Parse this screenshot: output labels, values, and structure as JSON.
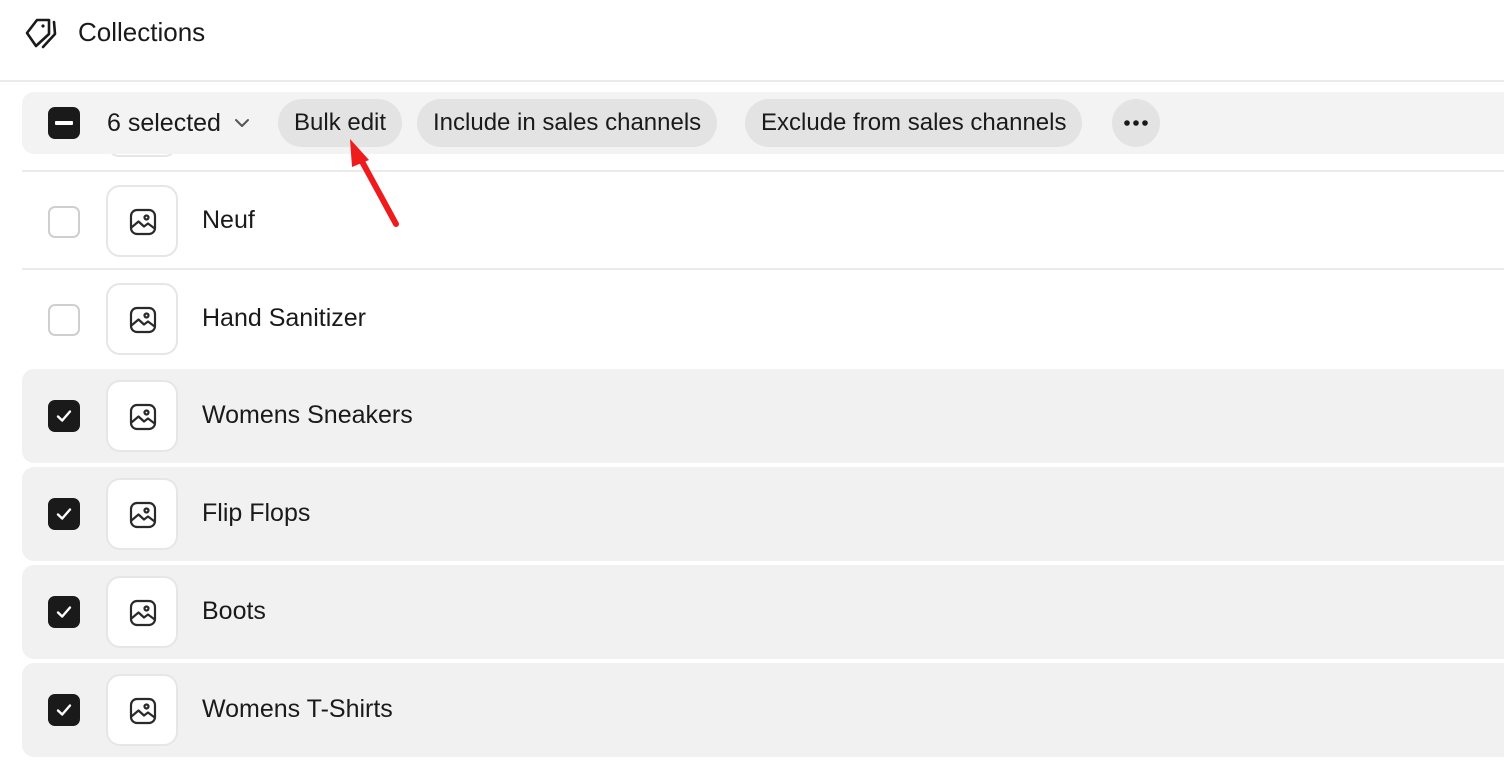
{
  "header": {
    "title": "Collections",
    "icon": "tag-icon"
  },
  "bulk_bar": {
    "selected_label": "6 selected",
    "actions": {
      "bulk_edit": "Bulk edit",
      "include": "Include in sales channels",
      "exclude": "Exclude from sales channels"
    },
    "more_icon": "more-horizontal-icon"
  },
  "rows": [
    {
      "name": "Neuf",
      "checked": false
    },
    {
      "name": "Hand Sanitizer",
      "checked": false
    },
    {
      "name": "Womens Sneakers",
      "checked": true
    },
    {
      "name": "Flip Flops",
      "checked": true
    },
    {
      "name": "Boots",
      "checked": true
    },
    {
      "name": "Womens T-Shirts",
      "checked": true
    }
  ],
  "annotation": {
    "color": "#ee1c1c",
    "points_to": "bulk-edit-button"
  }
}
